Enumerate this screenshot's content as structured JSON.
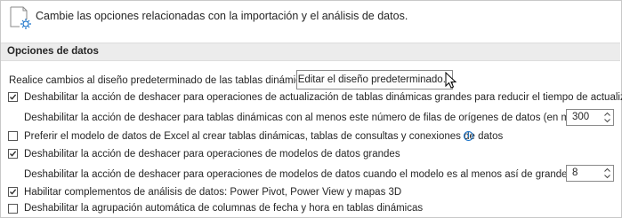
{
  "header": {
    "description": "Cambie las opciones relacionadas con la importación y el análisis de datos.",
    "icon": "data-options-icon"
  },
  "section": {
    "title": "Opciones de datos"
  },
  "default_layout": {
    "label": "Realice cambios al diseño predeterminado de las tablas dinámicas:",
    "button_label": "Editar el diseño predeterminado..."
  },
  "options": [
    {
      "label": "Deshabilitar la acción de deshacer para operaciones de actualización de tablas dinámicas grandes para reducir el tiempo de actualización",
      "checked": true
    },
    {
      "label": "Preferir el modelo de datos de Excel al crear tablas dinámicas, tablas de consultas y conexiones de datos",
      "checked": false
    },
    {
      "label": "Deshabilitar la acción de deshacer para operaciones de modelos de datos grandes",
      "checked": true
    },
    {
      "label": "Habilitar complementos de análisis de datos: Power Pivot, Power View y mapas 3D",
      "checked": true
    },
    {
      "label": "Deshabilitar la agrupación automática de columnas de fecha y hora en tablas dinámicas",
      "checked": false
    }
  ],
  "sub_options": {
    "pivot_rows": {
      "label": "Deshabilitar la acción de deshacer para tablas dinámicas con al menos este número de filas de orígenes de datos (en millares):",
      "value": "300"
    },
    "model_size": {
      "label": "Deshabilitar la acción de deshacer para operaciones de modelos de datos cuando el modelo es al menos así de grande (en MB):",
      "value": "8"
    }
  },
  "colors": {
    "accent": "#1a73c9",
    "section_bg": "#ececec",
    "text": "#262626"
  }
}
